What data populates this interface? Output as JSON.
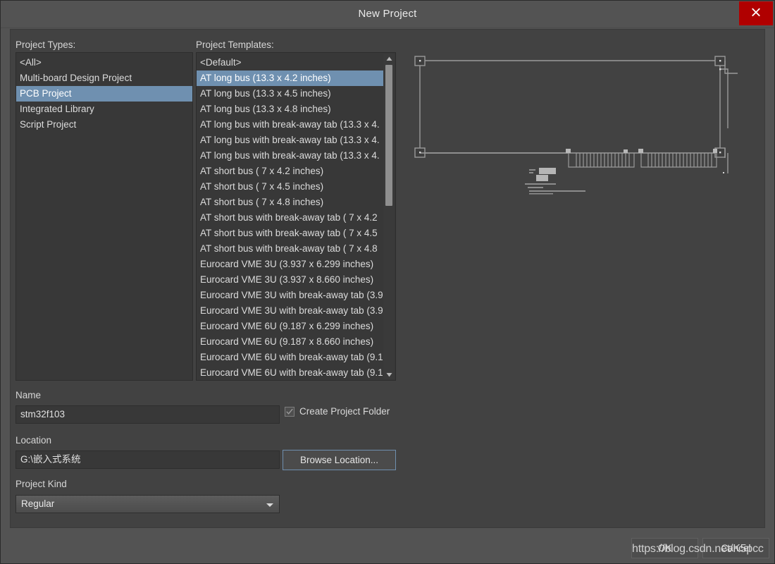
{
  "window": {
    "title": "New Project",
    "close_label": "x"
  },
  "labels": {
    "project_types": "Project Types:",
    "project_templates": "Project Templates:",
    "name": "Name",
    "location": "Location",
    "project_kind": "Project Kind"
  },
  "project_types": {
    "items": [
      "<All>",
      "Multi-board Design Project",
      "PCB Project",
      "Integrated Library",
      "Script Project"
    ],
    "selected_index": 2
  },
  "project_templates": {
    "items": [
      "<Default>",
      "AT long bus (13.3 x 4.2 inches)",
      "AT long bus (13.3 x 4.5 inches)",
      "AT long bus (13.3 x 4.8 inches)",
      "AT long bus with break-away tab (13.3 x 4.",
      "AT long bus with break-away tab (13.3 x 4.",
      "AT long bus with break-away tab (13.3 x 4.",
      "AT short bus ( 7 x 4.2 inches)",
      "AT short bus ( 7 x 4.5 inches)",
      "AT short bus ( 7 x 4.8 inches)",
      "AT short bus with break-away tab ( 7 x 4.2",
      "AT short bus with break-away tab ( 7 x 4.5",
      "AT short bus with break-away tab ( 7 x 4.8",
      "Eurocard VME 3U (3.937 x 6.299 inches)",
      "Eurocard VME 3U (3.937 x 8.660 inches)",
      "Eurocard VME 3U with break-away tab (3.9",
      "Eurocard VME 3U with break-away tab (3.9",
      "Eurocard VME 6U (9.187 x 6.299 inches)",
      "Eurocard VME 6U (9.187 x 8.660 inches)",
      "Eurocard VME 6U with break-away tab (9.1",
      "Eurocard VME 6U with break-away tab (9.1"
    ],
    "selected_index": 1
  },
  "form": {
    "name_value": "stm32f103",
    "location_value": "G:\\嵌入式系统",
    "project_kind_value": "Regular",
    "create_project_folder_label": "Create Project Folder",
    "create_project_folder_checked": true,
    "browse_location_label": "Browse Location..."
  },
  "footer": {
    "ok_label": "OK",
    "cancel_label": "Cancel"
  },
  "watermark": {
    "text": "https://blog.csdn.net/K5pcc"
  },
  "colors": {
    "accent_selection": "#6f90b0",
    "close_button": "#b00000",
    "panel_background": "#424242",
    "titlebar_background": "#535353",
    "listbox_background": "#383838"
  }
}
